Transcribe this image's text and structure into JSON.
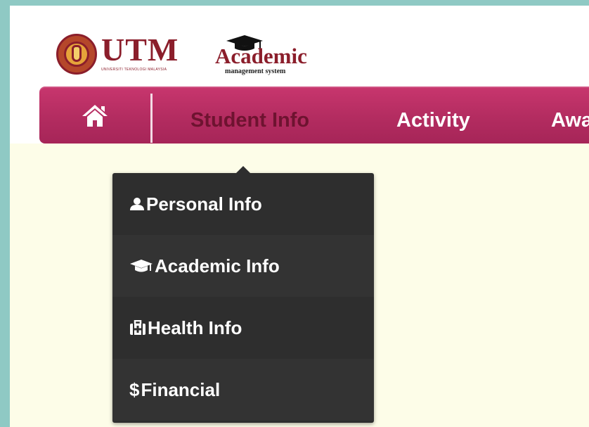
{
  "header": {
    "utm_logo": {
      "title": "UTM",
      "subtitle": "UNIVERSITI TEKNOLOGI MALAYSIA"
    },
    "academic_logo": {
      "title": "Academic",
      "subtitle": "management system"
    }
  },
  "navbar": {
    "home_icon": "home-icon",
    "items": [
      {
        "label": "Student Info",
        "active": true
      },
      {
        "label": "Activity",
        "active": false
      },
      {
        "label": "Awa",
        "active": false
      }
    ]
  },
  "dropdown": {
    "items": [
      {
        "icon": "user-icon",
        "label": "Personal Info"
      },
      {
        "icon": "graduation-cap-icon",
        "label": "Academic Info"
      },
      {
        "icon": "medkit-icon",
        "label": " Health Info"
      },
      {
        "icon": "dollar-icon",
        "symbol": "$",
        "label": "Financial"
      }
    ]
  },
  "colors": {
    "navbar": "#b32c60",
    "navbar_active_text": "#6e1330",
    "dropdown_bg": "#2e2e2e",
    "page_bg": "#fdfde8",
    "brand_maroon": "#8b1e2b",
    "outer_bg": "#8fc9c4"
  }
}
